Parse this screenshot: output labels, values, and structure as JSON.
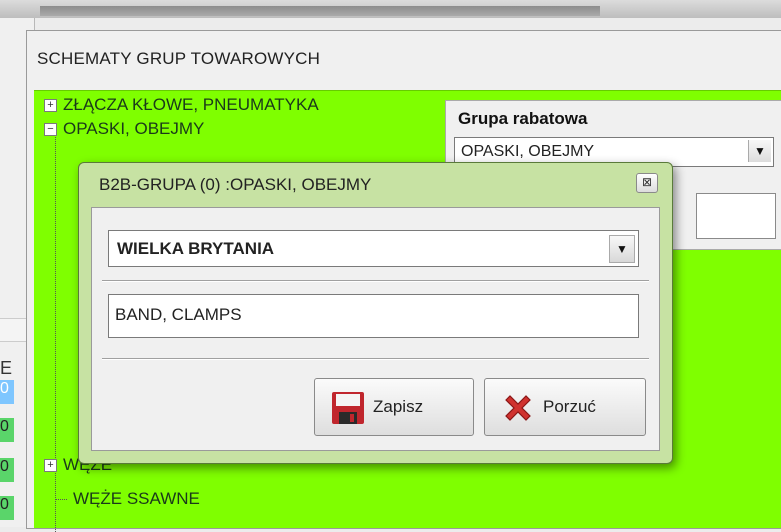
{
  "main": {
    "title": "SCHEMATY GRUP TOWAROWYCH",
    "tree": [
      {
        "expander": "+",
        "label": "ZŁĄCZA KŁOWE, PNEUMATYKA"
      },
      {
        "expander": "−",
        "label": "OPASKI, OBEJMY"
      },
      {
        "expander": "+",
        "label": "WĘŻE"
      },
      {
        "expander": "",
        "label": "WĘŻE SSAWNE"
      }
    ]
  },
  "rabat": {
    "label": "Grupa rabatowa",
    "value": "OPASKI, OBEJMY"
  },
  "leftpane": {
    "header_letter": "E",
    "cells": [
      "0",
      "0",
      "0",
      "0"
    ]
  },
  "dialog": {
    "title": "B2B-GRUPA (0) :OPASKI, OBEJMY",
    "close": "⊠",
    "language": "WIELKA BRYTANIA",
    "name_value": "BAND, CLAMPS",
    "save_label": "Zapisz",
    "cancel_label": "Porzuć"
  },
  "colors": {
    "tree_background": "#7fff00",
    "dialog_frame": "#c7e2a3",
    "save_icon": "#c0262d",
    "cancel_icon": "#d0322f"
  },
  "icons": {
    "save": "floppy-disk-icon",
    "cancel": "red-x-icon",
    "dropdown": "chevron-down-icon"
  }
}
